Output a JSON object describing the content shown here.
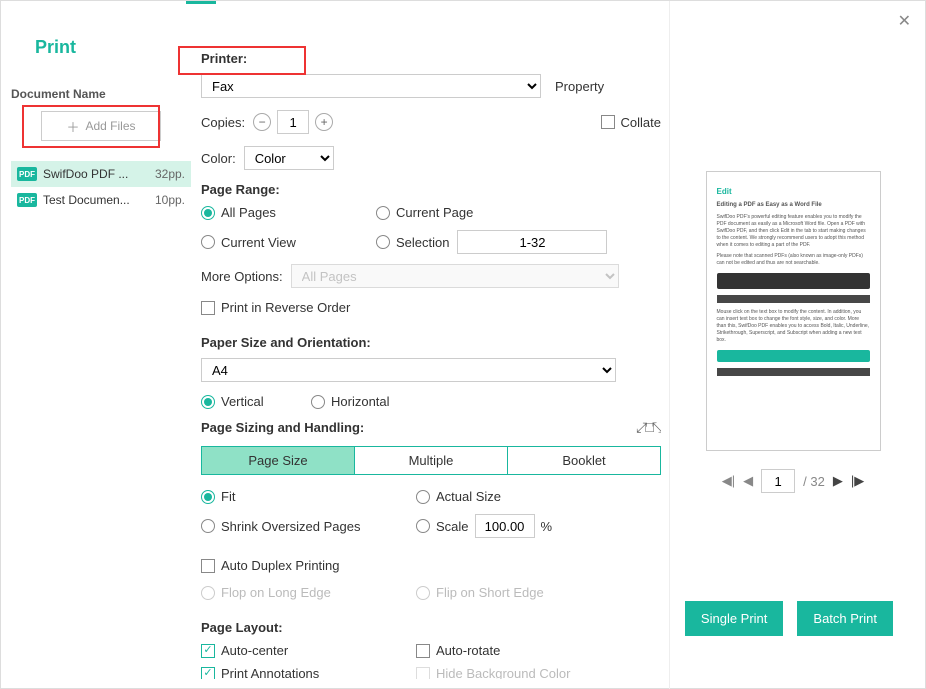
{
  "title": "Print",
  "sidebar": {
    "label": "Document Name",
    "add_files": "Add Files",
    "items": [
      {
        "name": "SwifDoo PDF ...",
        "pages": "32pp."
      },
      {
        "name": "Test Documen...",
        "pages": "10pp."
      }
    ]
  },
  "printer": {
    "label": "Printer:",
    "value": "Fax",
    "property": "Property",
    "copies_label": "Copies:",
    "copies": "1",
    "collate": "Collate",
    "color_label": "Color:",
    "color_value": "Color"
  },
  "range": {
    "label": "Page Range:",
    "all": "All Pages",
    "current_page": "Current Page",
    "current_view": "Current View",
    "selection": "Selection",
    "selection_value": "1-32",
    "more_label": "More Options:",
    "more_value": "All Pages",
    "reverse": "Print in Reverse Order"
  },
  "paper": {
    "label": "Paper Size and Orientation:",
    "size": "A4",
    "vertical": "Vertical",
    "horizontal": "Horizontal"
  },
  "sizing": {
    "label": "Page Sizing and Handling:",
    "tab_size": "Page Size",
    "tab_multiple": "Multiple",
    "tab_booklet": "Booklet",
    "fit": "Fit",
    "actual": "Actual Size",
    "shrink": "Shrink Oversized Pages",
    "scale": "Scale",
    "scale_value": "100.00",
    "percent": "%",
    "duplex": "Auto Duplex Printing",
    "flop_long": "Flop on Long Edge",
    "flip_short": "Flip on Short Edge"
  },
  "layout": {
    "label": "Page Layout:",
    "auto_center": "Auto-center",
    "auto_rotate": "Auto-rotate",
    "print_ann": "Print Annotations",
    "hide_bg": "Hide Background Color"
  },
  "preview": {
    "title": "Edit",
    "sub": "Editing a PDF as Easy as a Word File",
    "page": "1",
    "total": "/ 32"
  },
  "buttons": {
    "single": "Single Print",
    "batch": "Batch Print"
  }
}
